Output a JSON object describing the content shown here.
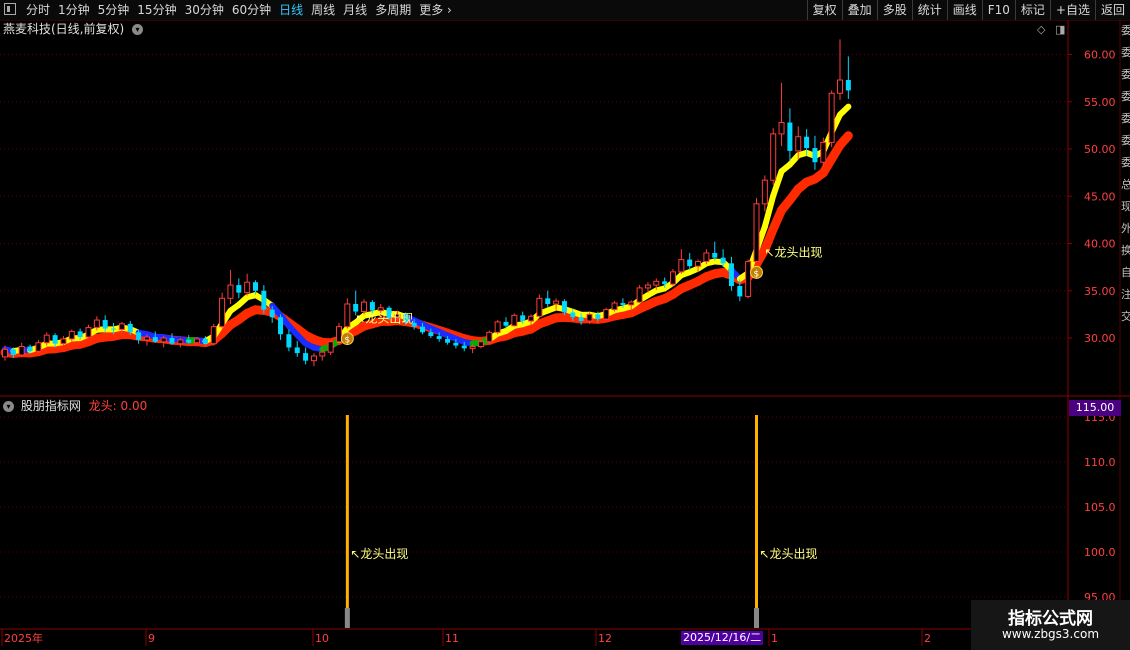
{
  "toolbar": {
    "periods": [
      "分时",
      "1分钟",
      "5分钟",
      "15分钟",
      "30分钟",
      "60分钟",
      "日线",
      "周线",
      "月线",
      "多周期",
      "更多"
    ],
    "active_period": "日线",
    "right_buttons": [
      "复权",
      "叠加",
      "多股",
      "统计",
      "画线",
      "F10",
      "标记",
      "+自选",
      "返回"
    ]
  },
  "main_chart": {
    "title": "燕麦科技(日线,前复权)",
    "signal_label": "龙头出现",
    "price_axis": [
      "60.00",
      "55.00",
      "50.00",
      "45.00",
      "40.00",
      "35.00",
      "30.00"
    ]
  },
  "indicator": {
    "title": "股朋指标网",
    "line_label": "龙头: 0.00",
    "axis": [
      "115.0",
      "110.0",
      "105.0",
      "100.0",
      "95.00"
    ],
    "current_value_box": "115.00",
    "signal_label": "龙头出现"
  },
  "time_axis": {
    "labels": [
      "2025年",
      "9",
      "10",
      "11",
      "12",
      "1",
      "2"
    ],
    "cursor_date": "2025/12/16/二"
  },
  "right_strip": [
    "委",
    "委",
    "委",
    "委",
    "委",
    "委",
    "委",
    "总",
    "现",
    "外",
    "换",
    "自",
    "注",
    "交"
  ],
  "watermark": {
    "line1": "指标公式网",
    "line2": "www.zbgs3.com"
  },
  "colors": {
    "up": "#ff3b3b",
    "down": "#00d8ff",
    "ma_fast": "#ffff00",
    "ma_slow": "#ff2a00",
    "ma_flat": "#00b000",
    "ma_down": "#1a2cff",
    "grid": "#5a0000",
    "axis_text": "#ff4040",
    "signal": "#ffb000"
  },
  "ohlc": [
    [
      28.0,
      29.2,
      27.6,
      28.8
    ],
    [
      28.8,
      29.0,
      27.9,
      28.2
    ],
    [
      28.2,
      29.5,
      28.0,
      29.1
    ],
    [
      29.1,
      29.3,
      28.3,
      28.6
    ],
    [
      28.6,
      29.8,
      28.4,
      29.5
    ],
    [
      29.5,
      30.6,
      29.2,
      30.3
    ],
    [
      30.3,
      30.5,
      29.0,
      29.4
    ],
    [
      29.4,
      30.2,
      29.1,
      29.9
    ],
    [
      29.9,
      30.9,
      29.6,
      30.7
    ],
    [
      30.7,
      31.0,
      29.8,
      30.1
    ],
    [
      30.1,
      31.4,
      30.0,
      31.1
    ],
    [
      31.1,
      32.3,
      30.8,
      31.9
    ],
    [
      31.9,
      32.4,
      30.6,
      31.0
    ],
    [
      31.0,
      31.6,
      30.4,
      30.9
    ],
    [
      30.9,
      31.7,
      30.5,
      31.5
    ],
    [
      31.5,
      31.8,
      30.3,
      30.6
    ],
    [
      30.6,
      30.9,
      29.4,
      29.8
    ],
    [
      29.8,
      30.4,
      29.2,
      30.1
    ],
    [
      30.1,
      30.7,
      29.5,
      29.6
    ],
    [
      29.6,
      30.2,
      29.0,
      30.0
    ],
    [
      30.0,
      30.5,
      29.3,
      29.4
    ],
    [
      29.4,
      30.0,
      29.0,
      29.8
    ],
    [
      29.8,
      30.3,
      29.4,
      29.5
    ],
    [
      29.5,
      30.1,
      29.2,
      29.9
    ],
    [
      29.9,
      30.2,
      29.3,
      29.4
    ],
    [
      29.4,
      31.5,
      29.2,
      31.2
    ],
    [
      31.2,
      34.8,
      31.0,
      34.2
    ],
    [
      34.2,
      37.2,
      33.6,
      35.6
    ],
    [
      35.6,
      36.3,
      34.2,
      34.8
    ],
    [
      34.8,
      36.8,
      34.5,
      35.9
    ],
    [
      35.9,
      36.1,
      34.6,
      35.0
    ],
    [
      35.0,
      35.6,
      32.6,
      33.0
    ],
    [
      33.0,
      33.4,
      31.6,
      32.2
    ],
    [
      32.2,
      32.5,
      29.8,
      30.4
    ],
    [
      30.4,
      30.9,
      28.6,
      29.0
    ],
    [
      29.0,
      29.7,
      28.0,
      28.4
    ],
    [
      28.4,
      29.0,
      27.2,
      27.6
    ],
    [
      27.6,
      28.4,
      27.0,
      28.1
    ],
    [
      28.1,
      28.9,
      27.6,
      28.5
    ],
    [
      28.5,
      29.8,
      28.2,
      29.6
    ],
    [
      29.6,
      31.6,
      29.4,
      31.2
    ],
    [
      31.2,
      34.2,
      31.0,
      33.6
    ],
    [
      33.6,
      35.0,
      32.4,
      32.8
    ],
    [
      32.8,
      34.1,
      32.5,
      33.8
    ],
    [
      33.8,
      34.0,
      32.6,
      32.9
    ],
    [
      32.9,
      33.6,
      32.0,
      33.2
    ],
    [
      33.2,
      33.4,
      31.9,
      32.1
    ],
    [
      32.1,
      32.9,
      31.6,
      32.5
    ],
    [
      32.5,
      32.7,
      31.4,
      31.6
    ],
    [
      31.6,
      32.0,
      30.9,
      31.2
    ],
    [
      31.2,
      31.6,
      30.4,
      30.6
    ],
    [
      30.6,
      31.0,
      30.0,
      30.2
    ],
    [
      30.2,
      30.6,
      29.6,
      29.9
    ],
    [
      29.9,
      30.2,
      29.3,
      29.5
    ],
    [
      29.5,
      29.9,
      28.9,
      29.2
    ],
    [
      29.2,
      29.6,
      28.6,
      28.9
    ],
    [
      28.9,
      29.4,
      28.4,
      29.1
    ],
    [
      29.1,
      29.8,
      28.9,
      29.6
    ],
    [
      29.6,
      30.8,
      29.4,
      30.6
    ],
    [
      30.6,
      31.9,
      30.4,
      31.7
    ],
    [
      31.7,
      32.2,
      31.0,
      31.3
    ],
    [
      31.3,
      32.6,
      31.2,
      32.4
    ],
    [
      32.4,
      32.8,
      31.5,
      31.8
    ],
    [
      31.8,
      32.5,
      31.4,
      32.3
    ],
    [
      32.3,
      34.6,
      32.1,
      34.2
    ],
    [
      34.2,
      35.0,
      33.2,
      33.6
    ],
    [
      33.6,
      34.2,
      33.0,
      33.9
    ],
    [
      33.9,
      34.1,
      32.4,
      32.7
    ],
    [
      32.7,
      33.1,
      31.8,
      32.2
    ],
    [
      32.2,
      32.6,
      31.4,
      31.8
    ],
    [
      31.8,
      32.7,
      31.5,
      32.5
    ],
    [
      32.5,
      32.8,
      31.7,
      32.0
    ],
    [
      32.0,
      33.2,
      31.9,
      33.0
    ],
    [
      33.0,
      33.9,
      32.8,
      33.7
    ],
    [
      33.7,
      34.2,
      33.2,
      33.5
    ],
    [
      33.5,
      34.0,
      32.9,
      33.8
    ],
    [
      33.8,
      35.6,
      33.7,
      35.3
    ],
    [
      35.3,
      35.9,
      34.8,
      35.6
    ],
    [
      35.6,
      36.3,
      35.1,
      36.0
    ],
    [
      36.0,
      36.4,
      35.3,
      35.7
    ],
    [
      35.7,
      37.3,
      35.5,
      37.0
    ],
    [
      37.0,
      39.4,
      36.8,
      38.3
    ],
    [
      38.3,
      39.0,
      37.2,
      37.6
    ],
    [
      37.6,
      38.3,
      37.0,
      38.1
    ],
    [
      38.1,
      39.4,
      37.8,
      39.0
    ],
    [
      39.0,
      40.2,
      38.2,
      38.5
    ],
    [
      38.5,
      39.4,
      37.5,
      37.9
    ],
    [
      37.9,
      38.6,
      35.0,
      35.5
    ],
    [
      35.5,
      36.2,
      33.9,
      34.4
    ],
    [
      34.4,
      38.3,
      34.2,
      38.1
    ],
    [
      38.1,
      44.8,
      38.0,
      44.2
    ],
    [
      44.2,
      47.2,
      43.4,
      46.7
    ],
    [
      46.7,
      52.2,
      46.2,
      51.6
    ],
    [
      51.6,
      57.0,
      50.3,
      52.8
    ],
    [
      52.8,
      54.3,
      48.7,
      49.8
    ],
    [
      49.8,
      52.4,
      48.9,
      51.3
    ],
    [
      51.3,
      52.1,
      49.3,
      50.1
    ],
    [
      50.1,
      51.4,
      47.8,
      48.6
    ],
    [
      48.6,
      51.2,
      48.1,
      50.7
    ],
    [
      50.7,
      56.2,
      50.2,
      55.9
    ],
    [
      55.9,
      61.6,
      55.2,
      57.3
    ],
    [
      57.3,
      59.8,
      55.3,
      56.2
    ]
  ],
  "signal_bars": [
    41,
    90
  ]
}
